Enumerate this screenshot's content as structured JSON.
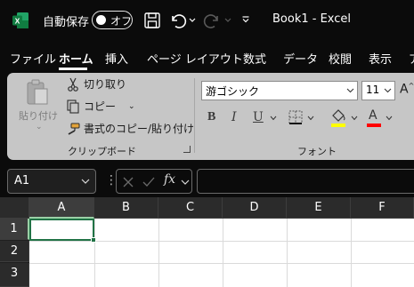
{
  "title_bar": {
    "autosave_label": "自動保存",
    "autosave_state": "オフ",
    "document_title": "Book1 - Excel"
  },
  "ribbon_tabs": [
    {
      "label": "ファイル"
    },
    {
      "label": "ホーム",
      "active": true
    },
    {
      "label": "挿入"
    },
    {
      "label": "ページ レイアウト"
    },
    {
      "label": "数式"
    },
    {
      "label": "データ"
    },
    {
      "label": "校閲"
    },
    {
      "label": "表示"
    },
    {
      "label": "ア"
    }
  ],
  "clipboard": {
    "paste_label": "貼り付け",
    "cut_label": "切り取り",
    "copy_label": "コピー",
    "format_painter_label": "書式のコピー/貼り付け",
    "group_label": "クリップボード"
  },
  "font": {
    "font_name": "游ゴシック",
    "font_size": "11",
    "grow_label": "A",
    "bold": "B",
    "italic": "I",
    "underline": "U",
    "font_color_label": "A",
    "group_label": "フォント"
  },
  "formula_bar": {
    "name_box_value": "A1",
    "separator": "⋮",
    "fx_label": "fx",
    "formula_value": ""
  },
  "grid": {
    "corner": "",
    "columns": [
      "A",
      "B",
      "C",
      "D",
      "E",
      "F"
    ],
    "rows": [
      "1",
      "2",
      "3"
    ],
    "selected_cell": "A1"
  },
  "colors": {
    "accent": "#217346",
    "app_background": "#0b0b0b",
    "ribbon": "#c6c6c6",
    "highlight_yellow": "#ffff00",
    "font_red": "#ff0000"
  }
}
